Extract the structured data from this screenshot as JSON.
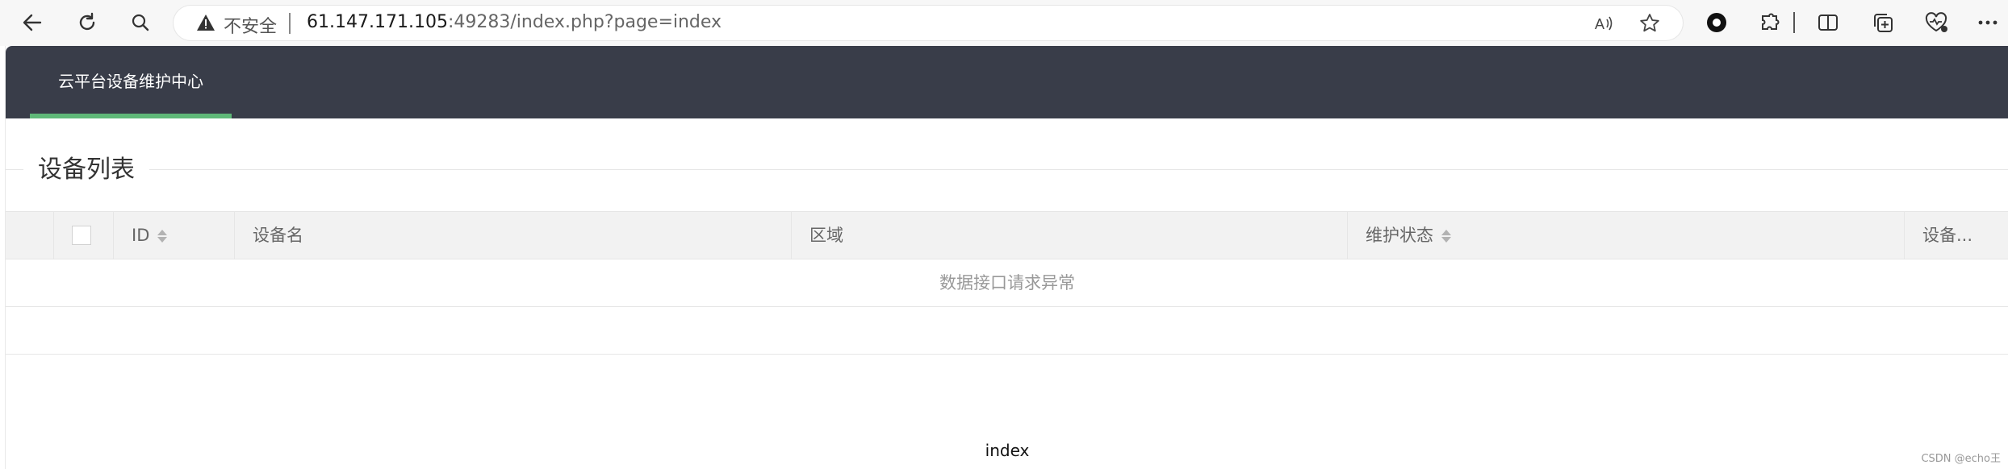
{
  "browser": {
    "security_label": "不安全",
    "url_host": "61.147.171.105",
    "url_rest": ":49283/index.php?page=index",
    "icons": [
      "back-icon",
      "reload-icon",
      "search-icon",
      "warning-icon",
      "read-aloud-icon",
      "favorite-icon",
      "record-icon",
      "extensions-icon",
      "split-screen-icon",
      "collections-icon",
      "health-icon",
      "more-icon"
    ]
  },
  "header": {
    "nav_title": "云平台设备维护中心",
    "accent_color": "#5fb878",
    "background_color": "#393d49"
  },
  "section": {
    "legend": "设备列表"
  },
  "table": {
    "columns": {
      "id": "ID",
      "name": "设备名",
      "region": "区域",
      "status": "维护状态",
      "extra": "设备..."
    },
    "empty_message": "数据接口请求异常"
  },
  "footer": {
    "text": "index"
  },
  "watermark": "CSDN @echo王"
}
